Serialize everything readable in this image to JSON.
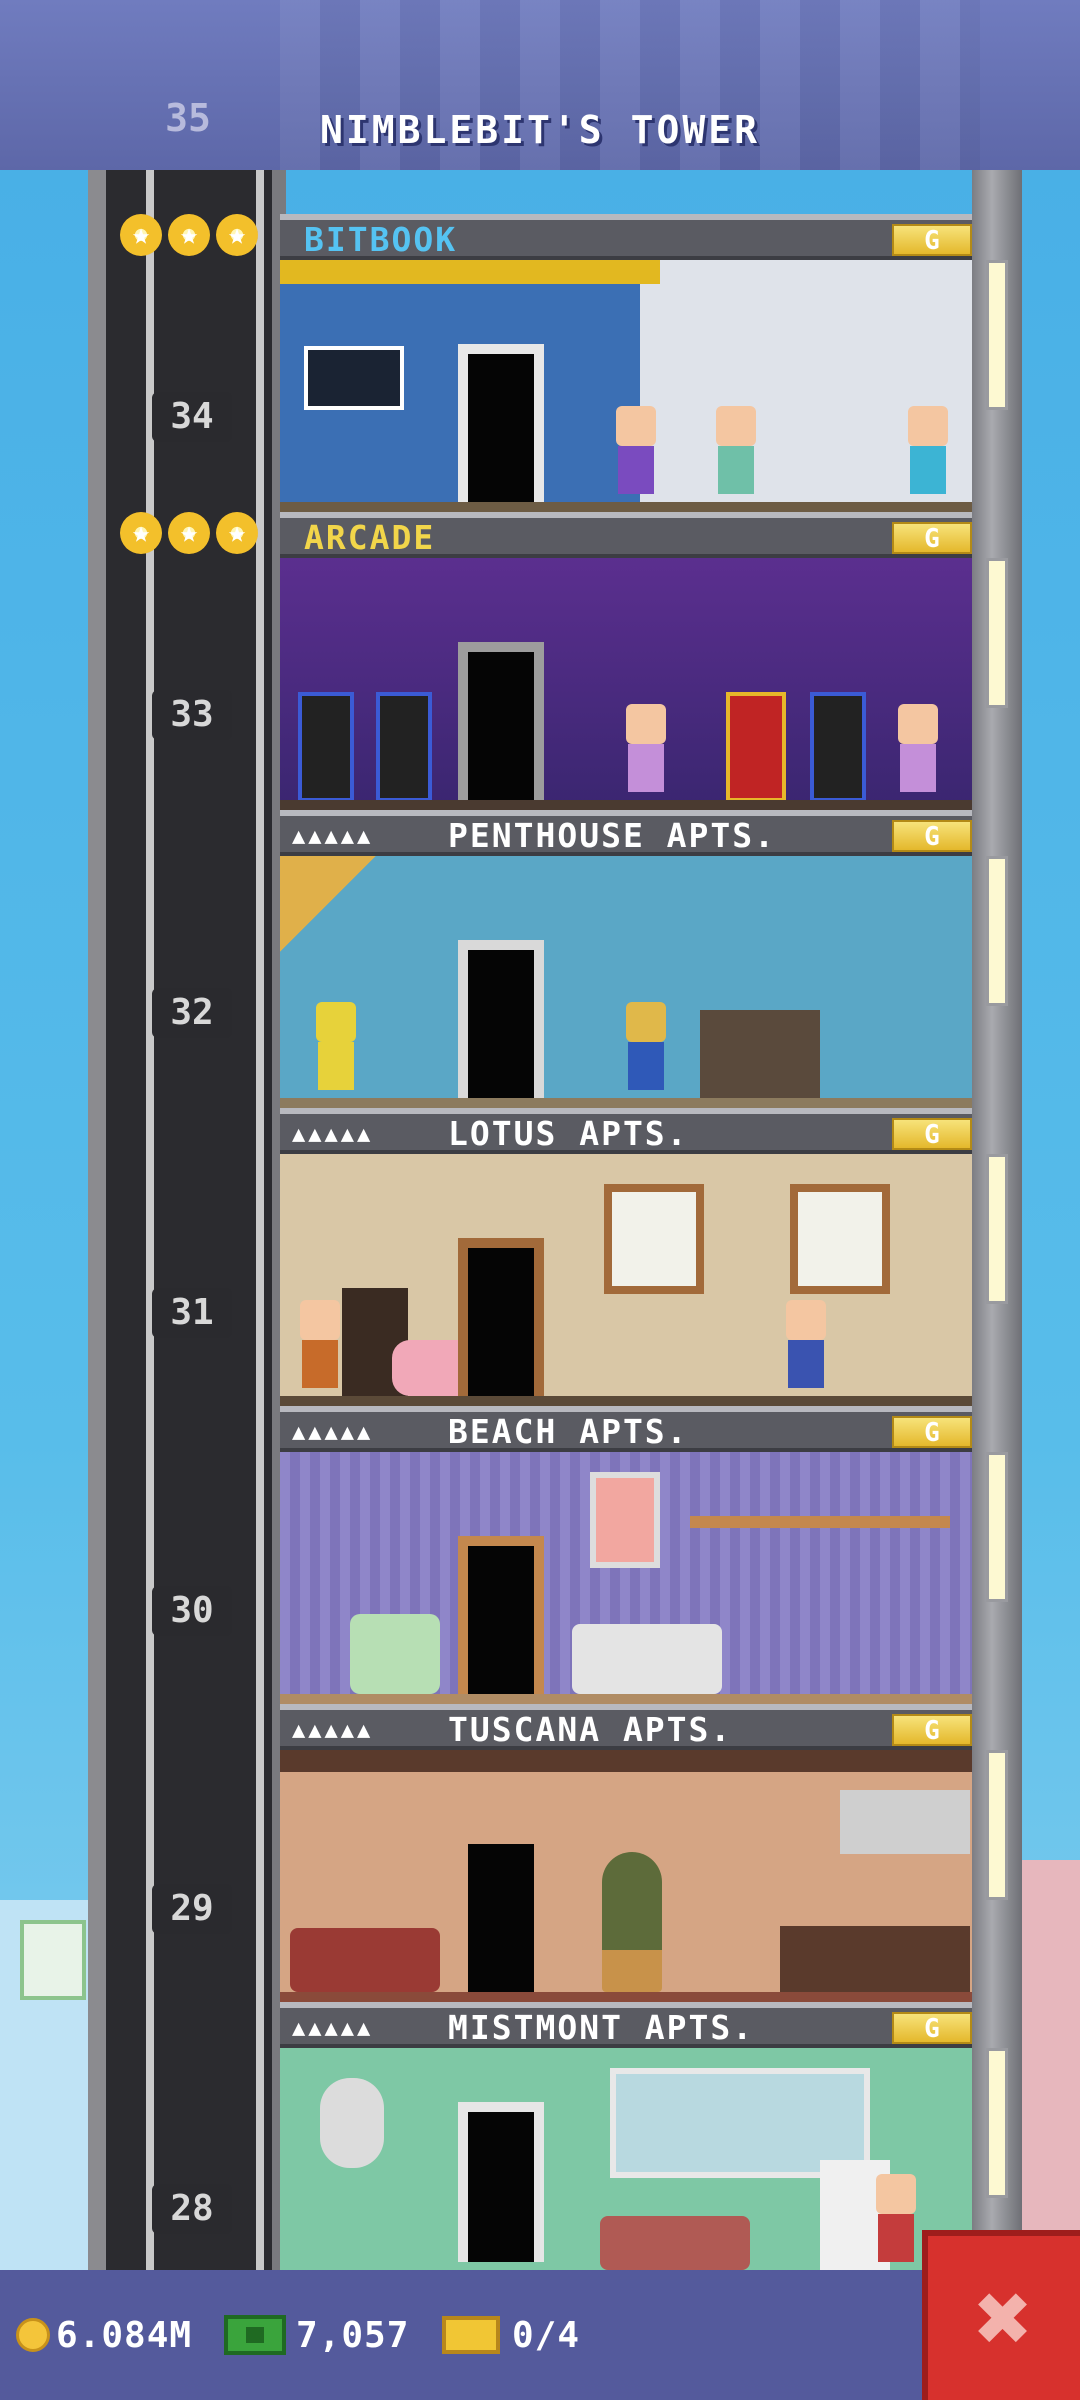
{
  "header": {
    "title": "NIMBLEBIT'S TOWER",
    "top_floor_number": "35"
  },
  "floors": [
    {
      "number": "34",
      "name": "BITBOOK",
      "name_color": "blue",
      "stars": 3,
      "residents_dots": "",
      "badge": "G"
    },
    {
      "number": "33",
      "name": "ARCADE",
      "name_color": "yellow",
      "stars": 3,
      "residents_dots": "",
      "badge": "G"
    },
    {
      "number": "32",
      "name": "PENTHOUSE APTS.",
      "name_color": "white",
      "stars": 0,
      "residents_dots": "▲▲▲▲▲",
      "badge": "G"
    },
    {
      "number": "31",
      "name": "LOTUS APTS.",
      "name_color": "white",
      "stars": 0,
      "residents_dots": "▲▲▲▲▲",
      "badge": "G"
    },
    {
      "number": "30",
      "name": "BEACH APTS.",
      "name_color": "white",
      "stars": 0,
      "residents_dots": "▲▲▲▲▲",
      "badge": "G"
    },
    {
      "number": "29",
      "name": "TUSCANA APTS.",
      "name_color": "white",
      "stars": 0,
      "residents_dots": "▲▲▲▲▲",
      "badge": "G"
    },
    {
      "number": "28",
      "name": "MISTMONT APTS.",
      "name_color": "white",
      "stars": 0,
      "residents_dots": "▲▲▲▲▲",
      "badge": "G"
    }
  ],
  "bottom_bar": {
    "coins": "6.084M",
    "bux": "7,057",
    "tickets": "0/4",
    "coin_icon": "coin-icon",
    "bux_icon": "bux-icon",
    "ticket_icon": "ticket-icon",
    "close_icon": "close-icon"
  },
  "colors": {
    "close_button": "#d7312d",
    "bar": "#545a9c",
    "sign_bg": "#5a5b62"
  }
}
